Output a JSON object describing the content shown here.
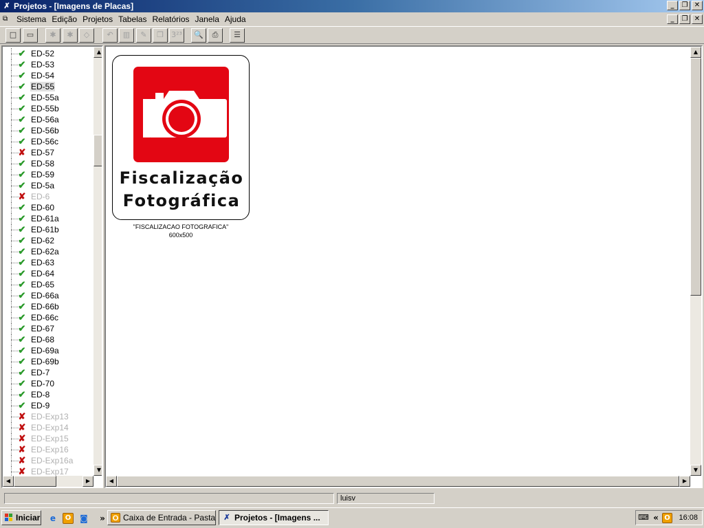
{
  "window": {
    "title": "Projetos - [Imagens de Placas]",
    "controls": [
      "_",
      "❐",
      "✕"
    ]
  },
  "menubar": {
    "items": [
      "Sistema",
      "Edição",
      "Projetos",
      "Tabelas",
      "Relatórios",
      "Janela",
      "Ajuda"
    ]
  },
  "toolbar": {
    "buttons": [
      {
        "icon": "new-document-icon",
        "glyph": "□"
      },
      {
        "icon": "open-folder-icon",
        "glyph": "▭"
      },
      {
        "icon": "tree-expand-icon",
        "glyph": "✱",
        "disabled": true
      },
      {
        "icon": "tree-collapse-icon",
        "glyph": "✱",
        "disabled": true
      },
      {
        "icon": "diamond-icon",
        "glyph": "◇",
        "disabled": true
      },
      {
        "icon": "undo-arrow-icon",
        "glyph": "↶",
        "disabled": true
      },
      {
        "icon": "columns-icon",
        "glyph": "▥",
        "disabled": true
      },
      {
        "icon": "edit-icon",
        "glyph": "✎",
        "disabled": true
      },
      {
        "icon": "copy-icon",
        "glyph": "❐",
        "disabled": true
      },
      {
        "icon": "superscript-icon",
        "glyph": "3²³",
        "disabled": true
      },
      {
        "icon": "magnifier-icon",
        "glyph": "🔍"
      },
      {
        "icon": "printer-icon",
        "glyph": "⎙"
      },
      {
        "icon": "list-icon",
        "glyph": "☰"
      }
    ]
  },
  "tree": {
    "items": [
      {
        "label": "ED-52",
        "status": "ok"
      },
      {
        "label": "ED-53",
        "status": "ok"
      },
      {
        "label": "ED-54",
        "status": "ok"
      },
      {
        "label": "ED-55",
        "status": "ok",
        "selected": true
      },
      {
        "label": "ED-55a",
        "status": "ok"
      },
      {
        "label": "ED-55b",
        "status": "ok"
      },
      {
        "label": "ED-56a",
        "status": "ok"
      },
      {
        "label": "ED-56b",
        "status": "ok"
      },
      {
        "label": "ED-56c",
        "status": "ok"
      },
      {
        "label": "ED-57",
        "status": "error"
      },
      {
        "label": "ED-58",
        "status": "ok"
      },
      {
        "label": "ED-59",
        "status": "ok"
      },
      {
        "label": "ED-5a",
        "status": "ok"
      },
      {
        "label": "ED-6",
        "status": "error",
        "inactive": true
      },
      {
        "label": "ED-60",
        "status": "ok"
      },
      {
        "label": "ED-61a",
        "status": "ok"
      },
      {
        "label": "ED-61b",
        "status": "ok"
      },
      {
        "label": "ED-62",
        "status": "ok"
      },
      {
        "label": "ED-62a",
        "status": "ok"
      },
      {
        "label": "ED-63",
        "status": "ok"
      },
      {
        "label": "ED-64",
        "status": "ok"
      },
      {
        "label": "ED-65",
        "status": "ok"
      },
      {
        "label": "ED-66a",
        "status": "ok"
      },
      {
        "label": "ED-66b",
        "status": "ok"
      },
      {
        "label": "ED-66c",
        "status": "ok"
      },
      {
        "label": "ED-67",
        "status": "ok"
      },
      {
        "label": "ED-68",
        "status": "ok"
      },
      {
        "label": "ED-69a",
        "status": "ok"
      },
      {
        "label": "ED-69b",
        "status": "ok"
      },
      {
        "label": "ED-7",
        "status": "ok"
      },
      {
        "label": "ED-70",
        "status": "ok"
      },
      {
        "label": "ED-8",
        "status": "ok"
      },
      {
        "label": "ED-9",
        "status": "ok"
      },
      {
        "label": "ED-Exp13",
        "status": "error",
        "inactive": true
      },
      {
        "label": "ED-Exp14",
        "status": "error",
        "inactive": true
      },
      {
        "label": "ED-Exp15",
        "status": "error",
        "inactive": true
      },
      {
        "label": "ED-Exp16",
        "status": "error",
        "inactive": true
      },
      {
        "label": "ED-Exp16a",
        "status": "error",
        "inactive": true
      },
      {
        "label": "ED-Exp17",
        "status": "error",
        "inactive": true
      }
    ]
  },
  "sign": {
    "line1": "Fiscalização",
    "line2": "Fotográfica",
    "caption_name": "\"FISCALIZACAO FOTOGRAFICA\"",
    "caption_size": "600x500",
    "colors": {
      "red": "#e30613",
      "white": "#ffffff"
    }
  },
  "statusbar": {
    "message": "",
    "user": "luisv"
  },
  "taskbar": {
    "start_label": "Iniciar",
    "chevron": "»",
    "tasks": [
      {
        "label": "Caixa de Entrada - Pasta...",
        "icon": "outlook-icon",
        "active": false
      },
      {
        "label": "Projetos - [Imagens ...",
        "icon": "app-icon",
        "active": true
      }
    ],
    "tray_chevron": "«",
    "clock": "16:08"
  }
}
